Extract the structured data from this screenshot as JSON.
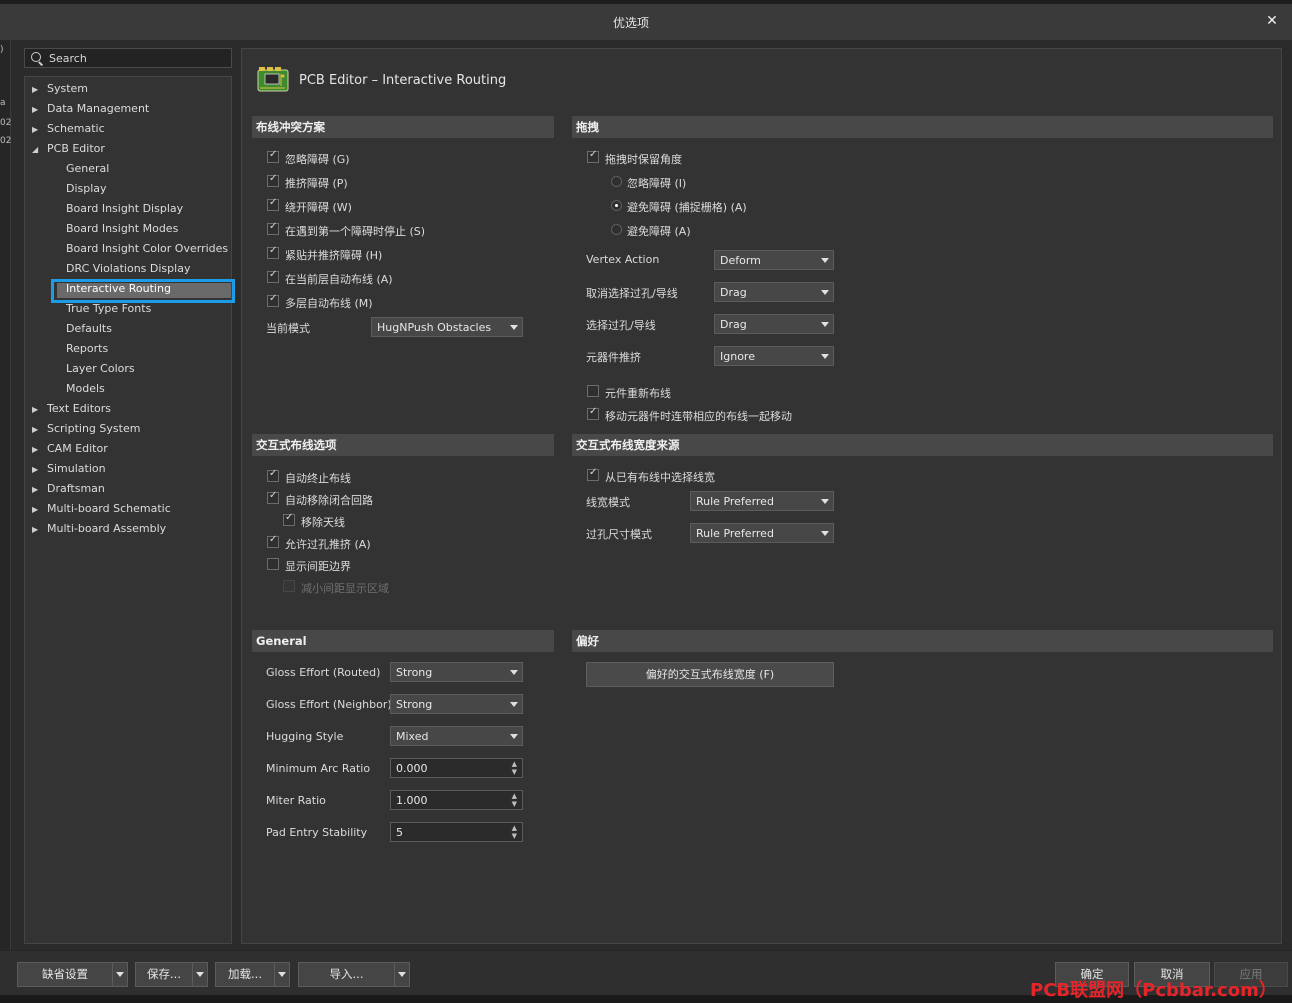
{
  "window": {
    "title": "优选项",
    "close_glyph": "✕"
  },
  "left_edge": [
    "a",
    "02",
    "02",
    ")"
  ],
  "search": {
    "placeholder": "Search"
  },
  "tree": [
    {
      "label": "System",
      "level": 0,
      "arrow": "▶"
    },
    {
      "label": "Data Management",
      "level": 0,
      "arrow": "▶"
    },
    {
      "label": "Schematic",
      "level": 0,
      "arrow": "▶"
    },
    {
      "label": "PCB Editor",
      "level": 0,
      "arrow": "◢"
    },
    {
      "label": "General",
      "level": 1
    },
    {
      "label": "Display",
      "level": 1
    },
    {
      "label": "Board Insight Display",
      "level": 1
    },
    {
      "label": "Board Insight Modes",
      "level": 1
    },
    {
      "label": "Board Insight Color Overrides",
      "level": 1
    },
    {
      "label": "DRC Violations Display",
      "level": 1
    },
    {
      "label": "Interactive Routing",
      "level": 1,
      "selected": true
    },
    {
      "label": "True Type Fonts",
      "level": 1
    },
    {
      "label": "Defaults",
      "level": 1
    },
    {
      "label": "Reports",
      "level": 1
    },
    {
      "label": "Layer Colors",
      "level": 1
    },
    {
      "label": "Models",
      "level": 1
    },
    {
      "label": "Text Editors",
      "level": 0,
      "arrow": "▶"
    },
    {
      "label": "Scripting System",
      "level": 0,
      "arrow": "▶"
    },
    {
      "label": "CAM Editor",
      "level": 0,
      "arrow": "▶"
    },
    {
      "label": "Simulation",
      "level": 0,
      "arrow": "▶"
    },
    {
      "label": "Draftsman",
      "level": 0,
      "arrow": "▶"
    },
    {
      "label": "Multi-board Schematic",
      "level": 0,
      "arrow": "▶"
    },
    {
      "label": "Multi-board Assembly",
      "level": 0,
      "arrow": "▶"
    }
  ],
  "page": {
    "title": "PCB Editor – Interactive Routing",
    "icon": "pcb-board-icon"
  },
  "sections": {
    "conflict": {
      "title": "布线冲突方案",
      "options": [
        {
          "label": "忽略障碍 (G)",
          "checked": true
        },
        {
          "label": "推挤障碍 (P)",
          "checked": true
        },
        {
          "label": "绕开障碍 (W)",
          "checked": true
        },
        {
          "label": "在遇到第一个障碍时停止 (S)",
          "checked": true
        },
        {
          "label": "紧贴并推挤障碍 (H)",
          "checked": true
        },
        {
          "label": "在当前层自动布线 (A)",
          "checked": true
        },
        {
          "label": "多层自动布线 (M)",
          "checked": true
        }
      ],
      "mode_label": "当前模式",
      "mode_value": "HugNPush Obstacles"
    },
    "drag": {
      "title": "拖拽",
      "keep_angle": {
        "label": "拖拽时保留角度",
        "checked": true
      },
      "radios": [
        {
          "label": "忽略障碍 (I)",
          "selected": false
        },
        {
          "label": "避免障碍 (捕捉栅格) (A)",
          "selected": true
        },
        {
          "label": "避免障碍 (A)",
          "selected": false
        }
      ],
      "combos": [
        {
          "label": "Vertex Action",
          "value": "Deform"
        },
        {
          "label": "取消选择过孔/导线",
          "value": "Drag"
        },
        {
          "label": "选择过孔/导线",
          "value": "Drag"
        },
        {
          "label": "元器件推挤",
          "value": "Ignore"
        }
      ],
      "checks": [
        {
          "label": "元件重新布线",
          "checked": false
        },
        {
          "label": "移动元器件时连带相应的布线一起移动",
          "checked": true
        }
      ]
    },
    "interactive": {
      "title": "交互式布线选项",
      "options": [
        {
          "label": "自动终止布线",
          "checked": true,
          "indent": 0,
          "disabled": false
        },
        {
          "label": "自动移除闭合回路",
          "checked": true,
          "indent": 0,
          "disabled": false
        },
        {
          "label": "移除天线",
          "checked": true,
          "indent": 1,
          "disabled": false
        },
        {
          "label": "允许过孔推挤 (A)",
          "checked": true,
          "indent": 0,
          "disabled": false
        },
        {
          "label": "显示间距边界",
          "checked": false,
          "indent": 0,
          "disabled": false
        },
        {
          "label": "减小间距显示区域",
          "checked": false,
          "indent": 1,
          "disabled": true
        }
      ]
    },
    "width_source": {
      "title": "交互式布线宽度来源",
      "pick_existing": {
        "label": "从已有布线中选择线宽",
        "checked": true
      },
      "combos": [
        {
          "label": "线宽模式",
          "value": "Rule Preferred"
        },
        {
          "label": "过孔尺寸模式",
          "value": "Rule Preferred"
        }
      ]
    },
    "general": {
      "title": "General",
      "rows": [
        {
          "label": "Gloss Effort (Routed)",
          "type": "combo",
          "value": "Strong"
        },
        {
          "label": "Gloss Effort (Neighbor)",
          "type": "combo",
          "value": "Strong"
        },
        {
          "label": "Hugging Style",
          "type": "combo",
          "value": "Mixed"
        },
        {
          "label": "Minimum Arc Ratio",
          "type": "spin",
          "value": "0.000"
        },
        {
          "label": "Miter Ratio",
          "type": "spin",
          "value": "1.000"
        },
        {
          "label": "Pad Entry Stability",
          "type": "spin",
          "value": "5"
        }
      ]
    },
    "prefs": {
      "title": "偏好",
      "button_label": "偏好的交互式布线宽度 (F)"
    }
  },
  "footer": {
    "buttons": [
      {
        "label": "缺省设置",
        "dropdown": true
      },
      {
        "label": "保存...",
        "dropdown": true
      },
      {
        "label": "加载...",
        "dropdown": true
      },
      {
        "label": "导入...",
        "dropdown": true
      }
    ],
    "ok": "确定",
    "cancel": "取消",
    "apply": "应用",
    "watermark": "PCB联盟网（Pcbbar.com）"
  }
}
